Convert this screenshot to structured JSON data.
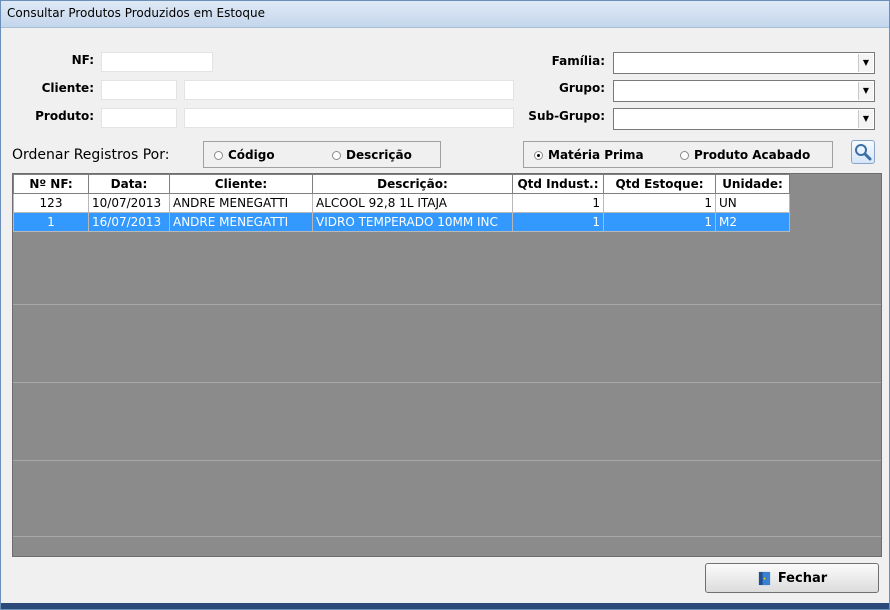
{
  "window": {
    "title": "Consultar Produtos Produzidos em Estoque"
  },
  "filters": {
    "nf_label": "NF:",
    "cliente_label": "Cliente:",
    "produto_label": "Produto:",
    "familia_label": "Família:",
    "grupo_label": "Grupo:",
    "subgrupo_label": "Sub-Grupo:"
  },
  "order": {
    "label": "Ordenar Registros Por:",
    "codigo": "Código",
    "descricao": "Descrição",
    "selected": "none"
  },
  "type": {
    "materia_prima": "Matéria Prima",
    "produto_acabado": "Produto Acabado",
    "selected": "materia_prima"
  },
  "grid": {
    "columns": [
      "Nº NF:",
      "Data:",
      "Cliente:",
      "Descrição:",
      "Qtd Indust.:",
      "Qtd Estoque:",
      "Unidade:"
    ],
    "rows": [
      [
        "123",
        "10/07/2013",
        "ANDRE MENEGATTI",
        "ALCOOL 92,8 1L ITAJA",
        "1",
        "1",
        "UN"
      ],
      [
        "1",
        "16/07/2013",
        "ANDRE MENEGATTI",
        "VIDRO TEMPERADO 10MM INC",
        "1",
        "1",
        "M2"
      ]
    ],
    "selected_row": 1
  },
  "buttons": {
    "close": "Fechar"
  },
  "colors": {
    "selection": "#3399ff",
    "grid_bg": "#8b8b8b"
  }
}
